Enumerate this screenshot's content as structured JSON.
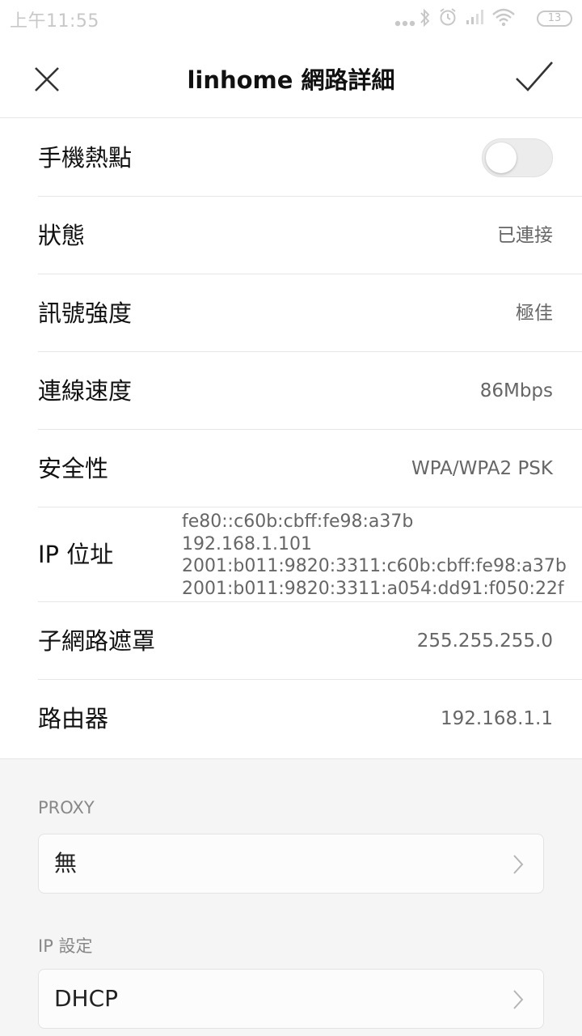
{
  "status_bar": {
    "time": "上午11:55",
    "battery": "13",
    "icons": [
      "more-dots-icon",
      "bluetooth-icon",
      "alarm-icon",
      "signal-icon",
      "wifi-icon",
      "battery-icon"
    ]
  },
  "header": {
    "title": "linhome 網路詳細"
  },
  "details": {
    "hotspot": {
      "label": "手機熱點",
      "enabled": false
    },
    "status": {
      "label": "狀態",
      "value": "已連接"
    },
    "signal": {
      "label": "訊號強度",
      "value": "極佳"
    },
    "speed": {
      "label": "連線速度",
      "value": "86Mbps"
    },
    "security": {
      "label": "安全性",
      "value": "WPA/WPA2 PSK"
    },
    "ip": {
      "label": "IP 位址",
      "lines": [
        "fe80::c60b:cbff:fe98:a37b",
        "192.168.1.101",
        "2001:b011:9820:3311:c60b:cbff:fe98:a37b",
        "2001:b011:9820:3311:a054:dd91:f050:22f"
      ]
    },
    "subnet": {
      "label": "子網路遮罩",
      "value": "255.255.255.0"
    },
    "router": {
      "label": "路由器",
      "value": "192.168.1.1"
    }
  },
  "proxy": {
    "label": "PROXY",
    "value": "無"
  },
  "ip_settings": {
    "label": "IP 設定",
    "value": "DHCP"
  },
  "colors": {
    "text_primary": "#111111",
    "text_secondary": "#666666",
    "divider": "#e6e6e6",
    "section_bg": "#f5f5f5"
  }
}
